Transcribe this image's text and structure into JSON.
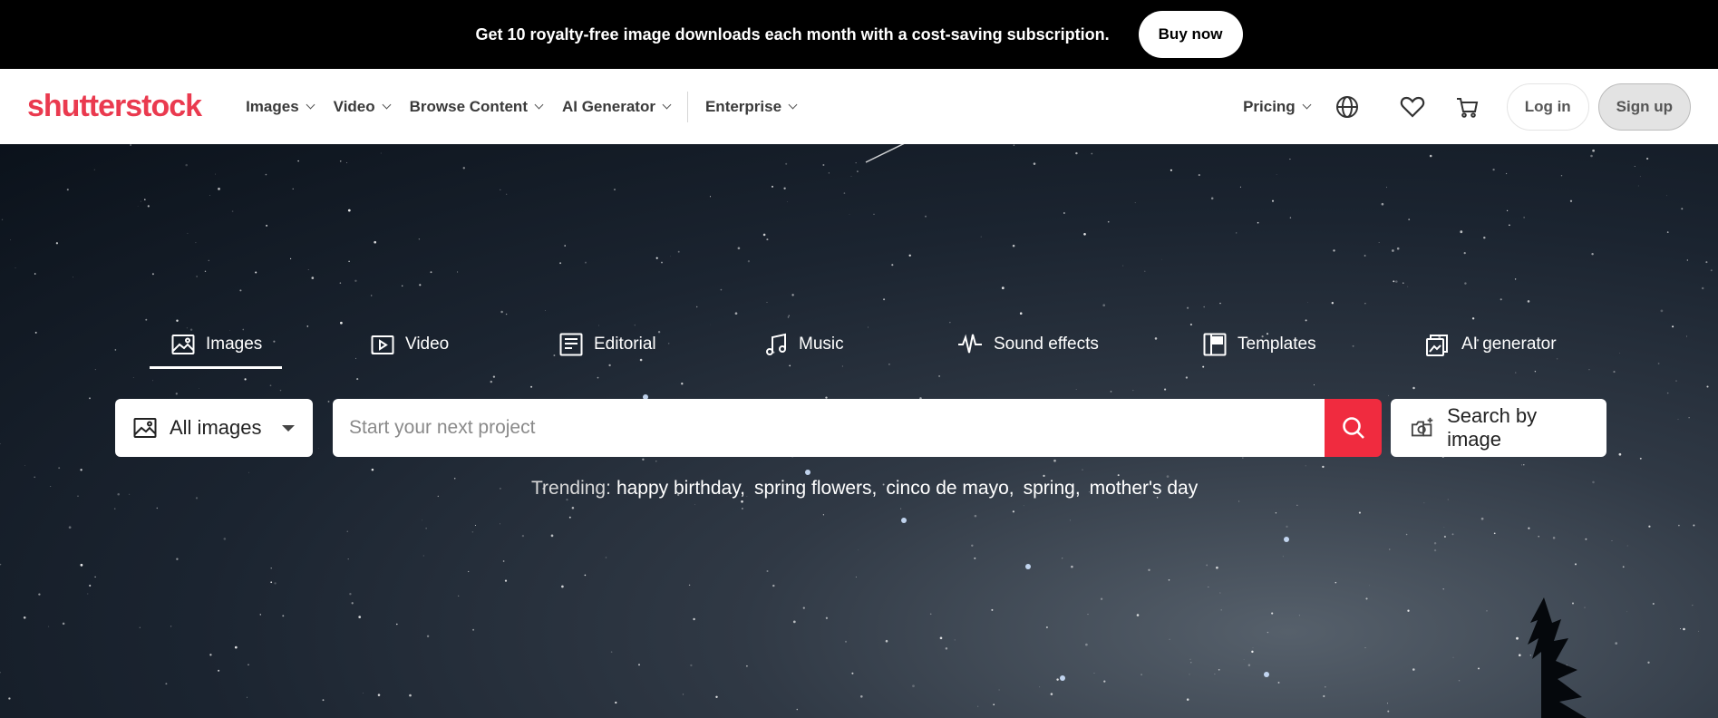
{
  "promo": {
    "text": "Get 10 royalty-free image downloads each month with a cost-saving subscription.",
    "button": "Buy now"
  },
  "nav": {
    "logo": "shutterstock",
    "items": [
      "Images",
      "Video",
      "Browse Content",
      "AI Generator",
      "Enterprise"
    ],
    "pricing": "Pricing",
    "login": "Log in",
    "signup": "Sign up"
  },
  "hero": {
    "tabs": [
      "Images",
      "Video",
      "Editorial",
      "Music",
      "Sound effects",
      "Templates",
      "AI generator"
    ],
    "active_tab": "Images",
    "type_select": "All images",
    "search_placeholder": "Start your next project",
    "image_search": "Search by image",
    "trending_label": "Trending:",
    "trending": [
      "happy birthday,",
      "spring flowers,",
      "cinco de mayo,",
      "spring,",
      "mother's day"
    ]
  },
  "colors": {
    "brand": "#ea3a4f",
    "search_button": "#f02b3f",
    "banner": "#000000"
  },
  "icons": {
    "globe": "globe-icon",
    "heart": "heart-icon",
    "cart": "cart-icon",
    "search": "search-icon"
  }
}
